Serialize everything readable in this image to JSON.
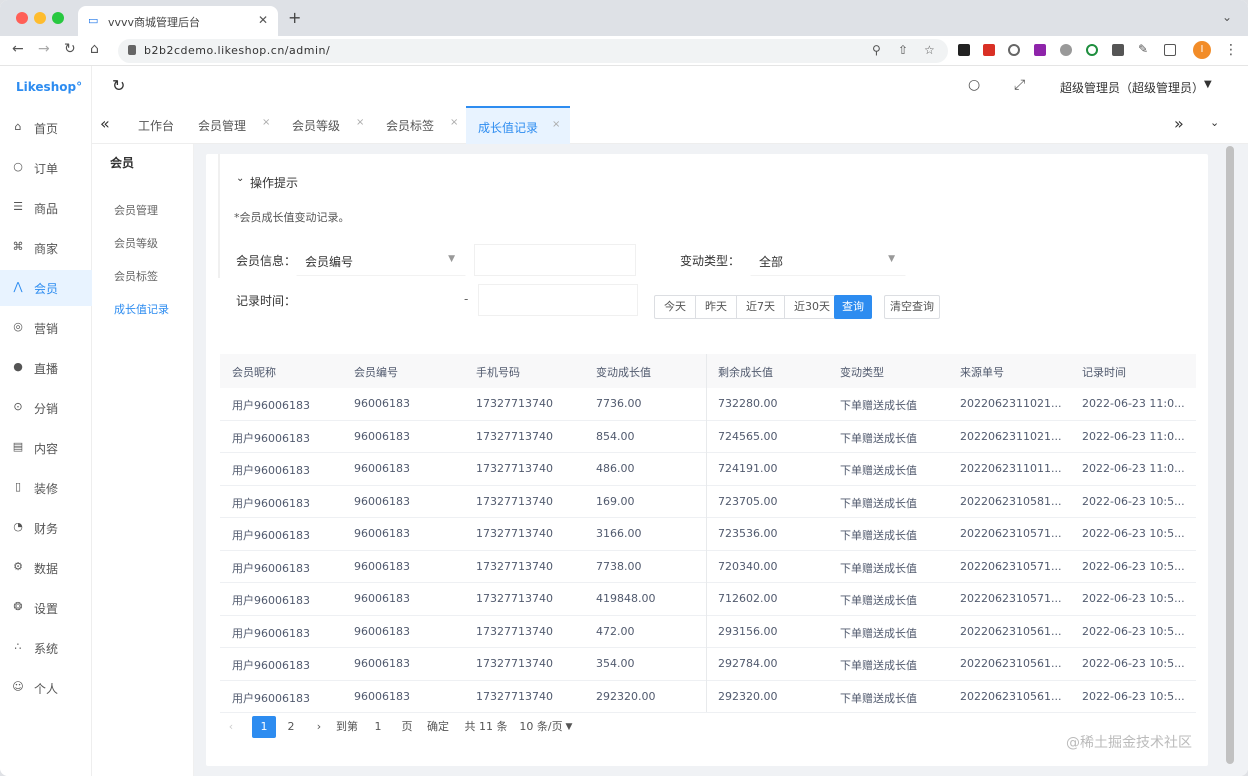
{
  "browser": {
    "tab_title": "vvvv商城管理后台",
    "url": "b2b2cdemo.likeshop.cn/admin/",
    "avatar_letter": "I"
  },
  "app": {
    "logo": "Likeshop°",
    "user_name": "超级管理员（超级管理员）"
  },
  "sidebar": {
    "items": [
      {
        "label": "首页",
        "icon": "home-icon",
        "glyph": "⌂"
      },
      {
        "label": "订单",
        "icon": "order-icon",
        "glyph": "○"
      },
      {
        "label": "商品",
        "icon": "goods-icon",
        "glyph": "☰"
      },
      {
        "label": "商家",
        "icon": "shop-icon",
        "glyph": "⌘"
      },
      {
        "label": "会员",
        "icon": "user-icon",
        "glyph": "⋀"
      },
      {
        "label": "营销",
        "icon": "marketing-icon",
        "glyph": "◎"
      },
      {
        "label": "直播",
        "icon": "live-icon",
        "glyph": "●"
      },
      {
        "label": "分销",
        "icon": "distribution-icon",
        "glyph": "⊙"
      },
      {
        "label": "内容",
        "icon": "content-icon",
        "glyph": "▤"
      },
      {
        "label": "装修",
        "icon": "decorate-icon",
        "glyph": "▯"
      },
      {
        "label": "财务",
        "icon": "finance-icon",
        "glyph": "◔"
      },
      {
        "label": "数据",
        "icon": "data-icon",
        "glyph": "⚙"
      },
      {
        "label": "设置",
        "icon": "settings-icon",
        "glyph": "❂"
      },
      {
        "label": "系统",
        "icon": "system-icon",
        "glyph": "∴"
      },
      {
        "label": "个人",
        "icon": "person-icon",
        "glyph": "☺"
      }
    ]
  },
  "submenu": {
    "title": "会员",
    "items": [
      "会员管理",
      "会员等级",
      "会员标签",
      "成长值记录"
    ]
  },
  "tags": [
    "工作台",
    "会员管理",
    "会员等级",
    "会员标签",
    "成长值记录"
  ],
  "tips": {
    "title": "操作提示",
    "text": "*会员成长值变动记录。"
  },
  "filters": {
    "member_label": "会员信息：",
    "member_select": "会员编号",
    "type_label": "变动类型：",
    "type_select": "全部",
    "time_label": "记录时间：",
    "date_sep": "-",
    "quick": [
      "今天",
      "昨天",
      "近7天",
      "近30天"
    ],
    "search": "查询",
    "reset": "清空查询"
  },
  "table": {
    "headers": [
      "会员昵称",
      "会员编号",
      "手机号码",
      "变动成长值",
      "剩余成长值",
      "变动类型",
      "来源单号",
      "记录时间"
    ],
    "rows": [
      [
        "用户96006183",
        "96006183",
        "17327713740",
        "7736.00",
        "732280.00",
        "下单赠送成长值",
        "2022062311021...",
        "2022-06-23 11:0..."
      ],
      [
        "用户96006183",
        "96006183",
        "17327713740",
        "854.00",
        "724565.00",
        "下单赠送成长值",
        "2022062311021...",
        "2022-06-23 11:0..."
      ],
      [
        "用户96006183",
        "96006183",
        "17327713740",
        "486.00",
        "724191.00",
        "下单赠送成长值",
        "2022062311011...",
        "2022-06-23 11:0..."
      ],
      [
        "用户96006183",
        "96006183",
        "17327713740",
        "169.00",
        "723705.00",
        "下单赠送成长值",
        "2022062310581...",
        "2022-06-23 10:5..."
      ],
      [
        "用户96006183",
        "96006183",
        "17327713740",
        "3166.00",
        "723536.00",
        "下单赠送成长值",
        "2022062310571...",
        "2022-06-23 10:5..."
      ],
      [
        "用户96006183",
        "96006183",
        "17327713740",
        "7738.00",
        "720340.00",
        "下单赠送成长值",
        "2022062310571...",
        "2022-06-23 10:5..."
      ],
      [
        "用户96006183",
        "96006183",
        "17327713740",
        "419848.00",
        "712602.00",
        "下单赠送成长值",
        "2022062310571...",
        "2022-06-23 10:5..."
      ],
      [
        "用户96006183",
        "96006183",
        "17327713740",
        "472.00",
        "293156.00",
        "下单赠送成长值",
        "2022062310561...",
        "2022-06-23 10:5..."
      ],
      [
        "用户96006183",
        "96006183",
        "17327713740",
        "354.00",
        "292784.00",
        "下单赠送成长值",
        "2022062310561...",
        "2022-06-23 10:5..."
      ],
      [
        "用户96006183",
        "96006183",
        "17327713740",
        "292320.00",
        "292320.00",
        "下单赠送成长值",
        "2022062310561...",
        "2022-06-23 10:5..."
      ]
    ]
  },
  "pager": {
    "prev": "‹",
    "pages": [
      "1",
      "2"
    ],
    "next": "›",
    "goto_label": "到第",
    "goto_value": "1",
    "goto_unit": "页",
    "confirm": "确定",
    "total": "共 11 条",
    "size": "10 条/页"
  },
  "watermark": "@稀土掘金技术社区"
}
